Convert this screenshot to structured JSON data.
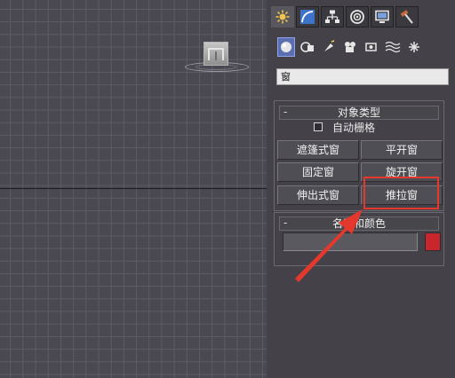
{
  "viewport": {
    "object_label": "roll-up icon object"
  },
  "panel": {
    "tabs": [
      {
        "icon": "create-star-icon",
        "active": true
      },
      {
        "icon": "modify-curve-icon",
        "active": false
      },
      {
        "icon": "hierarchy-icon",
        "active": false
      },
      {
        "icon": "motion-ring-icon",
        "active": false
      },
      {
        "icon": "display-monitor-icon",
        "active": false
      },
      {
        "icon": "utilities-hammer-icon",
        "active": false
      }
    ],
    "sub_icons": [
      "geometry-sphere-icon",
      "shapes-icon",
      "lights-icon",
      "cameras-icon",
      "helpers-icon",
      "spacewarps-icon",
      "systems-icon"
    ],
    "type_select": {
      "value": "窗"
    },
    "object_type": {
      "title": "对象类型",
      "collapse": "-",
      "autogrid_label": "自动栅格",
      "autogrid_checked": false,
      "buttons": [
        "遮篷式窗",
        "平开窗",
        "固定窗",
        "旋开窗",
        "伸出式窗",
        "推拉窗"
      ]
    },
    "name_color": {
      "title": "名称和颜色",
      "collapse": "-",
      "name_value": "",
      "swatch_color": "#c8262c"
    }
  },
  "annotation": {
    "highlight_color": "#e5382d"
  }
}
